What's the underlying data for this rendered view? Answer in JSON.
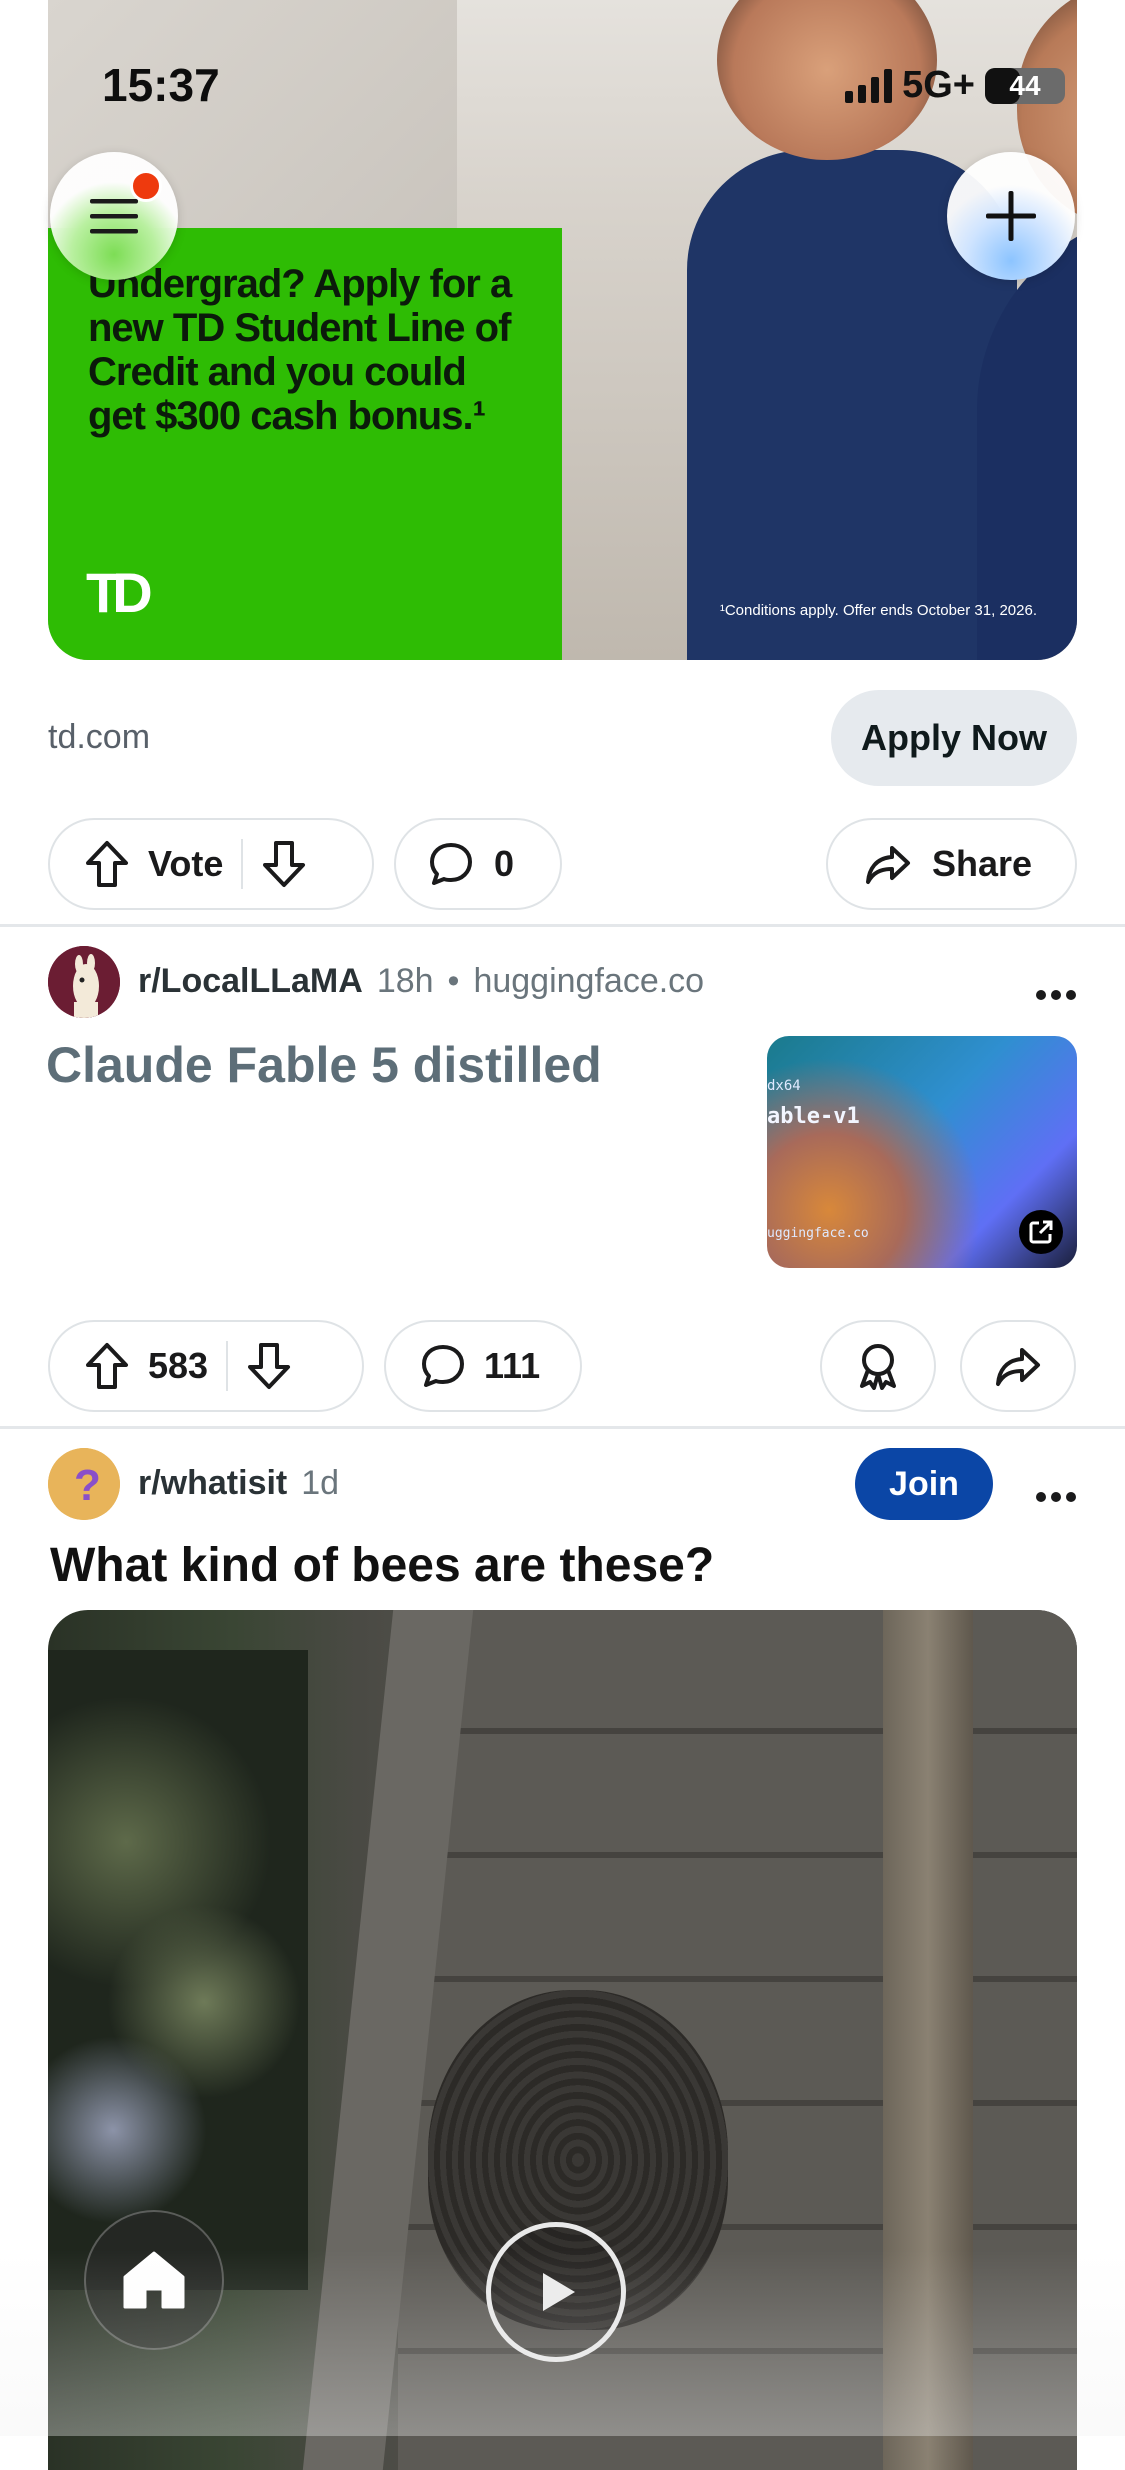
{
  "status_bar": {
    "time": "15:37",
    "network": "5G+",
    "battery": "44",
    "battery_level": 0.44
  },
  "ad": {
    "headline": "Undergrad? Apply for a new TD Student Line of Credit and you could get $300 cash bonus.¹",
    "logo_text": "TD",
    "disclaimer": "¹Conditions apply. Offer ends October 31, 2026.",
    "domain": "td.com",
    "cta": "Apply Now",
    "vote_label": "Vote",
    "comments": "0",
    "share_label": "Share",
    "colors": {
      "green": "#2ebc04",
      "scrubs": "#1f3566"
    }
  },
  "post1": {
    "subreddit": "r/LocalLLaMA",
    "age": "18h",
    "separator": "•",
    "source": "huggingface.co",
    "title": "Claude Fable 5 distilled",
    "thumb_line1": "dx64",
    "thumb_line2": "able-v1",
    "thumb_line3": "uggingface.co",
    "upvotes": "583",
    "comments": "111"
  },
  "post2": {
    "subreddit": "r/whatisit",
    "age": "1d",
    "join_label": "Join",
    "title": "What kind of bees are these?"
  },
  "colors": {
    "join_blue": "#0b46a6",
    "notif_red": "#ee3a0e",
    "divider": "#e4e7ea"
  },
  "icons": [
    "menu-icon",
    "plus-icon",
    "upvote-icon",
    "downvote-icon",
    "comment-icon",
    "share-icon",
    "award-icon",
    "external-link-icon",
    "play-icon",
    "home-icon",
    "more-icon"
  ]
}
